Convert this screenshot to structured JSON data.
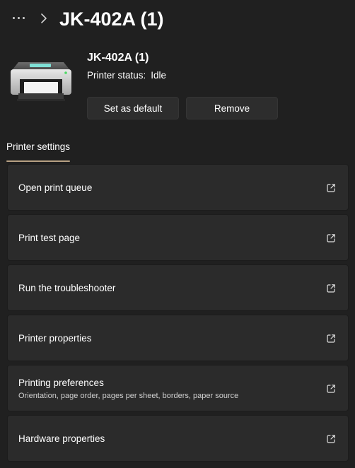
{
  "header": {
    "more_glyph": "•••",
    "title": "JK-402A (1)"
  },
  "device": {
    "name": "JK-402A (1)",
    "status_label": "Printer status:",
    "status_value": "Idle",
    "icon": "printer-icon"
  },
  "actions": {
    "set_default_label": "Set as default",
    "remove_label": "Remove"
  },
  "section": {
    "tab_label": "Printer settings"
  },
  "settings": [
    {
      "title": "Open print queue",
      "icon": "open-external-icon"
    },
    {
      "title": "Print test page",
      "icon": "open-external-icon"
    },
    {
      "title": "Run the troubleshooter",
      "icon": "open-external-icon"
    },
    {
      "title": "Printer properties",
      "icon": "open-external-icon"
    },
    {
      "title": "Printing preferences",
      "subtitle": "Orientation, page order, pages per sheet, borders, paper source",
      "icon": "open-external-icon"
    },
    {
      "title": "Hardware properties",
      "icon": "open-external-icon"
    }
  ],
  "colors": {
    "background": "#202020",
    "card": "#2b2b2b",
    "button": "#2d2d2d",
    "accent_underline": "#b7a183",
    "status_led": "#4cd964"
  }
}
